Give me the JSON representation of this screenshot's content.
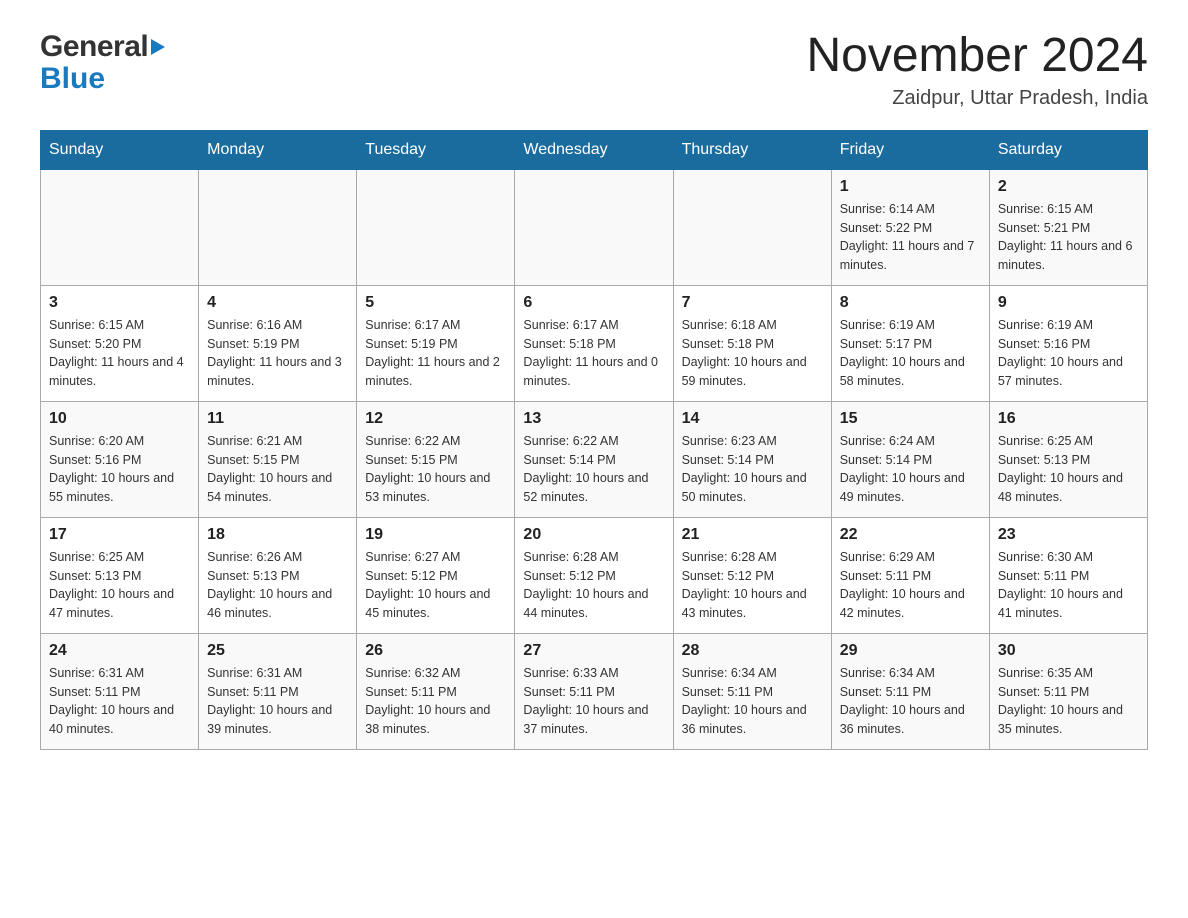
{
  "header": {
    "month_title": "November 2024",
    "location": "Zaidpur, Uttar Pradesh, India",
    "logo_general": "General",
    "logo_blue": "Blue"
  },
  "weekdays": [
    "Sunday",
    "Monday",
    "Tuesday",
    "Wednesday",
    "Thursday",
    "Friday",
    "Saturday"
  ],
  "weeks": [
    {
      "days": [
        {
          "number": "",
          "info": ""
        },
        {
          "number": "",
          "info": ""
        },
        {
          "number": "",
          "info": ""
        },
        {
          "number": "",
          "info": ""
        },
        {
          "number": "",
          "info": ""
        },
        {
          "number": "1",
          "info": "Sunrise: 6:14 AM\nSunset: 5:22 PM\nDaylight: 11 hours and 7 minutes."
        },
        {
          "number": "2",
          "info": "Sunrise: 6:15 AM\nSunset: 5:21 PM\nDaylight: 11 hours and 6 minutes."
        }
      ]
    },
    {
      "days": [
        {
          "number": "3",
          "info": "Sunrise: 6:15 AM\nSunset: 5:20 PM\nDaylight: 11 hours and 4 minutes."
        },
        {
          "number": "4",
          "info": "Sunrise: 6:16 AM\nSunset: 5:19 PM\nDaylight: 11 hours and 3 minutes."
        },
        {
          "number": "5",
          "info": "Sunrise: 6:17 AM\nSunset: 5:19 PM\nDaylight: 11 hours and 2 minutes."
        },
        {
          "number": "6",
          "info": "Sunrise: 6:17 AM\nSunset: 5:18 PM\nDaylight: 11 hours and 0 minutes."
        },
        {
          "number": "7",
          "info": "Sunrise: 6:18 AM\nSunset: 5:18 PM\nDaylight: 10 hours and 59 minutes."
        },
        {
          "number": "8",
          "info": "Sunrise: 6:19 AM\nSunset: 5:17 PM\nDaylight: 10 hours and 58 minutes."
        },
        {
          "number": "9",
          "info": "Sunrise: 6:19 AM\nSunset: 5:16 PM\nDaylight: 10 hours and 57 minutes."
        }
      ]
    },
    {
      "days": [
        {
          "number": "10",
          "info": "Sunrise: 6:20 AM\nSunset: 5:16 PM\nDaylight: 10 hours and 55 minutes."
        },
        {
          "number": "11",
          "info": "Sunrise: 6:21 AM\nSunset: 5:15 PM\nDaylight: 10 hours and 54 minutes."
        },
        {
          "number": "12",
          "info": "Sunrise: 6:22 AM\nSunset: 5:15 PM\nDaylight: 10 hours and 53 minutes."
        },
        {
          "number": "13",
          "info": "Sunrise: 6:22 AM\nSunset: 5:14 PM\nDaylight: 10 hours and 52 minutes."
        },
        {
          "number": "14",
          "info": "Sunrise: 6:23 AM\nSunset: 5:14 PM\nDaylight: 10 hours and 50 minutes."
        },
        {
          "number": "15",
          "info": "Sunrise: 6:24 AM\nSunset: 5:14 PM\nDaylight: 10 hours and 49 minutes."
        },
        {
          "number": "16",
          "info": "Sunrise: 6:25 AM\nSunset: 5:13 PM\nDaylight: 10 hours and 48 minutes."
        }
      ]
    },
    {
      "days": [
        {
          "number": "17",
          "info": "Sunrise: 6:25 AM\nSunset: 5:13 PM\nDaylight: 10 hours and 47 minutes."
        },
        {
          "number": "18",
          "info": "Sunrise: 6:26 AM\nSunset: 5:13 PM\nDaylight: 10 hours and 46 minutes."
        },
        {
          "number": "19",
          "info": "Sunrise: 6:27 AM\nSunset: 5:12 PM\nDaylight: 10 hours and 45 minutes."
        },
        {
          "number": "20",
          "info": "Sunrise: 6:28 AM\nSunset: 5:12 PM\nDaylight: 10 hours and 44 minutes."
        },
        {
          "number": "21",
          "info": "Sunrise: 6:28 AM\nSunset: 5:12 PM\nDaylight: 10 hours and 43 minutes."
        },
        {
          "number": "22",
          "info": "Sunrise: 6:29 AM\nSunset: 5:11 PM\nDaylight: 10 hours and 42 minutes."
        },
        {
          "number": "23",
          "info": "Sunrise: 6:30 AM\nSunset: 5:11 PM\nDaylight: 10 hours and 41 minutes."
        }
      ]
    },
    {
      "days": [
        {
          "number": "24",
          "info": "Sunrise: 6:31 AM\nSunset: 5:11 PM\nDaylight: 10 hours and 40 minutes."
        },
        {
          "number": "25",
          "info": "Sunrise: 6:31 AM\nSunset: 5:11 PM\nDaylight: 10 hours and 39 minutes."
        },
        {
          "number": "26",
          "info": "Sunrise: 6:32 AM\nSunset: 5:11 PM\nDaylight: 10 hours and 38 minutes."
        },
        {
          "number": "27",
          "info": "Sunrise: 6:33 AM\nSunset: 5:11 PM\nDaylight: 10 hours and 37 minutes."
        },
        {
          "number": "28",
          "info": "Sunrise: 6:34 AM\nSunset: 5:11 PM\nDaylight: 10 hours and 36 minutes."
        },
        {
          "number": "29",
          "info": "Sunrise: 6:34 AM\nSunset: 5:11 PM\nDaylight: 10 hours and 36 minutes."
        },
        {
          "number": "30",
          "info": "Sunrise: 6:35 AM\nSunset: 5:11 PM\nDaylight: 10 hours and 35 minutes."
        }
      ]
    }
  ]
}
